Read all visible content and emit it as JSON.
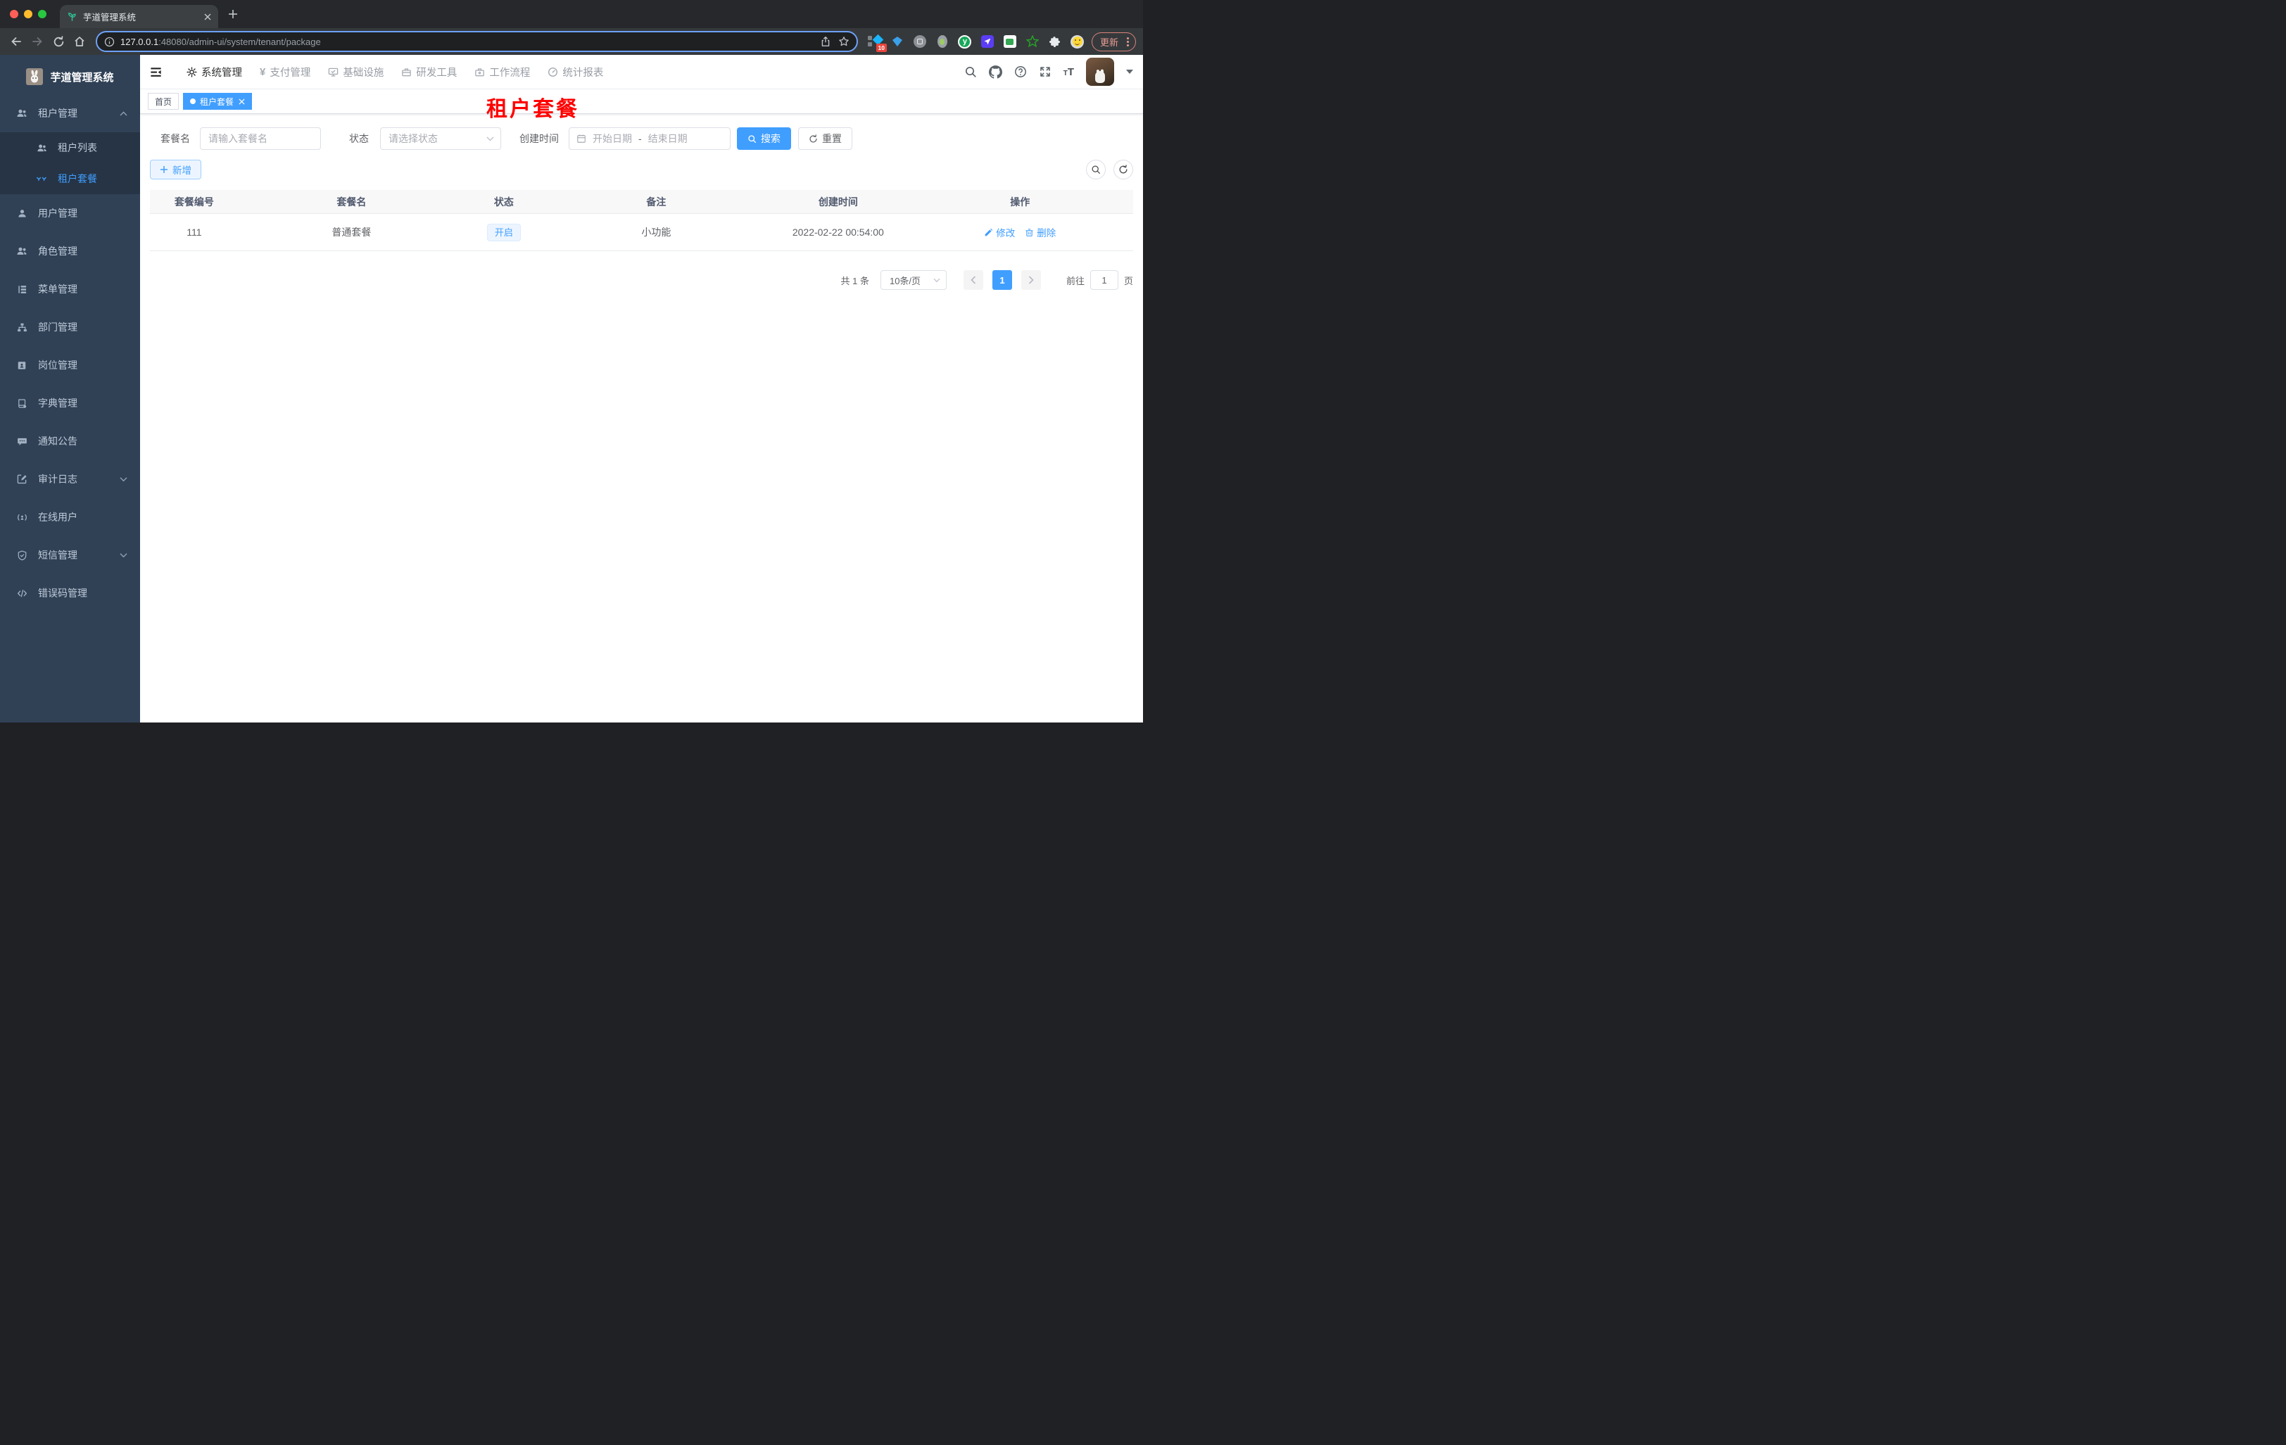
{
  "browser": {
    "tab_title": "芋道管理系统",
    "url_host": "127.0.0.1",
    "url_rest": ":48080/admin-ui/system/tenant/package",
    "extension_badge": "10",
    "update_label": "更新"
  },
  "header": {
    "pay_symbol": "¥",
    "nav": [
      {
        "label": "系统管理"
      },
      {
        "label": "支付管理"
      },
      {
        "label": "基础设施"
      },
      {
        "label": "研发工具"
      },
      {
        "label": "工作流程"
      },
      {
        "label": "统计报表"
      }
    ]
  },
  "sidebar": {
    "title": "芋道管理系统",
    "items": [
      {
        "label": "租户管理"
      },
      {
        "label": "租户列表"
      },
      {
        "label": "租户套餐"
      },
      {
        "label": "用户管理"
      },
      {
        "label": "角色管理"
      },
      {
        "label": "菜单管理"
      },
      {
        "label": "部门管理"
      },
      {
        "label": "岗位管理"
      },
      {
        "label": "字典管理"
      },
      {
        "label": "通知公告"
      },
      {
        "label": "审计日志"
      },
      {
        "label": "在线用户"
      },
      {
        "label": "短信管理"
      },
      {
        "label": "错误码管理"
      }
    ]
  },
  "tags": {
    "home": "首页",
    "active": "租户套餐"
  },
  "page_title": "租户套餐",
  "filters": {
    "name_label": "套餐名",
    "name_placeholder": "请输入套餐名",
    "status_label": "状态",
    "status_placeholder": "请选择状态",
    "date_label": "创建时间",
    "date_start": "开始日期",
    "date_separator": "-",
    "date_end": "结束日期",
    "search_label": "搜索",
    "reset_label": "重置"
  },
  "actions": {
    "add_label": "新增"
  },
  "table": {
    "columns": [
      "套餐编号",
      "套餐名",
      "状态",
      "备注",
      "创建时间",
      "操作"
    ],
    "rows": [
      {
        "id": "111",
        "name": "普通套餐",
        "status": "开启",
        "remark": "小功能",
        "created_at": "2022-02-22 00:54:00",
        "edit_label": "修改",
        "delete_label": "删除"
      }
    ]
  },
  "pagination": {
    "total_text": "共 1 条",
    "page_size": "10条/页",
    "current_page": "1",
    "goto_label": "前往",
    "goto_value": "1",
    "goto_unit": "页"
  },
  "colors": {
    "primary": "#409eff",
    "sidebar_bg": "#304156",
    "submenu_bg": "#263445",
    "page_title_red": "#fe0100",
    "active_tag_bg": "#409eff"
  }
}
